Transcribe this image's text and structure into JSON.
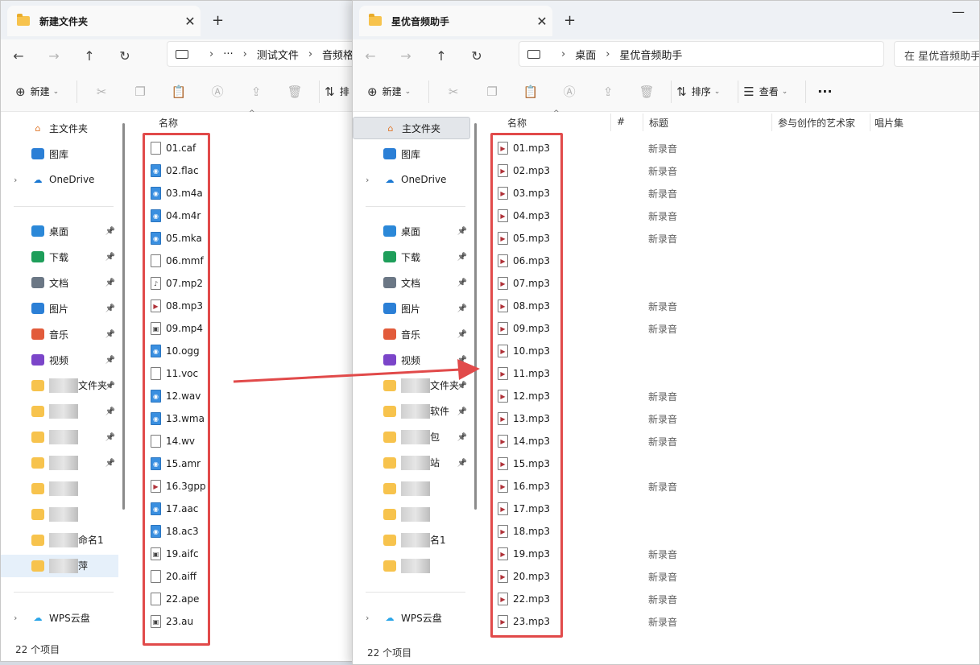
{
  "colors": {
    "accent": "#0067c0",
    "annotation": "#e14a4a",
    "folder": "#f7c34d"
  },
  "window_left": {
    "tab_title": "新建文件夹",
    "address": [
      "测试文件",
      "音频格"
    ],
    "address_more": "···",
    "toolbar": {
      "new_label": "新建",
      "sort_partial": "排"
    },
    "column_name": "名称",
    "files": [
      {
        "name": "01.caf",
        "icon": "file-icon"
      },
      {
        "name": "02.flac",
        "icon": "audio-icon"
      },
      {
        "name": "03.m4a",
        "icon": "audio-icon"
      },
      {
        "name": "04.m4r",
        "icon": "audio-icon"
      },
      {
        "name": "05.mka",
        "icon": "audio-icon"
      },
      {
        "name": "06.mmf",
        "icon": "file-icon"
      },
      {
        "name": "07.mp2",
        "icon": "music-note-icon"
      },
      {
        "name": "08.mp3",
        "icon": "media-icon"
      },
      {
        "name": "09.mp4",
        "icon": "video-icon"
      },
      {
        "name": "10.ogg",
        "icon": "audio-icon"
      },
      {
        "name": "11.voc",
        "icon": "file-icon"
      },
      {
        "name": "12.wav",
        "icon": "audio-icon"
      },
      {
        "name": "13.wma",
        "icon": "audio-icon"
      },
      {
        "name": "14.wv",
        "icon": "file-icon"
      },
      {
        "name": "15.amr",
        "icon": "audio-icon"
      },
      {
        "name": "16.3gpp",
        "icon": "media-icon"
      },
      {
        "name": "17.aac",
        "icon": "audio-icon"
      },
      {
        "name": "18.ac3",
        "icon": "audio-icon"
      },
      {
        "name": "19.aifc",
        "icon": "video-icon"
      },
      {
        "name": "20.aiff",
        "icon": "file-icon"
      },
      {
        "name": "22.ape",
        "icon": "file-icon"
      },
      {
        "name": "23.au",
        "icon": "video-icon"
      }
    ],
    "status": "22 个项目"
  },
  "window_right": {
    "tab_title": "星优音频助手",
    "address": [
      "桌面",
      "星优音频助手"
    ],
    "search_placeholder": "在 星优音频助手",
    "toolbar": {
      "new_label": "新建",
      "sort_label": "排序",
      "view_label": "查看",
      "more": "···"
    },
    "columns": [
      "名称",
      "#",
      "标题",
      "参与创作的艺术家",
      "唱片集"
    ],
    "files": [
      {
        "name": "01.mp3",
        "title": "新录音"
      },
      {
        "name": "02.mp3",
        "title": "新录音"
      },
      {
        "name": "03.mp3",
        "title": "新录音"
      },
      {
        "name": "04.mp3",
        "title": "新录音"
      },
      {
        "name": "05.mp3",
        "title": "新录音"
      },
      {
        "name": "06.mp3",
        "title": ""
      },
      {
        "name": "07.mp3",
        "title": ""
      },
      {
        "name": "08.mp3",
        "title": "新录音"
      },
      {
        "name": "09.mp3",
        "title": "新录音"
      },
      {
        "name": "10.mp3",
        "title": ""
      },
      {
        "name": "11.mp3",
        "title": ""
      },
      {
        "name": "12.mp3",
        "title": "新录音"
      },
      {
        "name": "13.mp3",
        "title": "新录音"
      },
      {
        "name": "14.mp3",
        "title": "新录音"
      },
      {
        "name": "15.mp3",
        "title": ""
      },
      {
        "name": "16.mp3",
        "title": "新录音"
      },
      {
        "name": "17.mp3",
        "title": ""
      },
      {
        "name": "18.mp3",
        "title": ""
      },
      {
        "name": "19.mp3",
        "title": "新录音"
      },
      {
        "name": "20.mp3",
        "title": "新录音"
      },
      {
        "name": "22.mp3",
        "title": "新录音"
      },
      {
        "name": "23.mp3",
        "title": "新录音"
      }
    ],
    "status": "22 个项目"
  },
  "sidebar": {
    "home": "主文件夹",
    "gallery": "图库",
    "onedrive": "OneDrive",
    "pinned": [
      {
        "label": "桌面",
        "icon": "desktop-icon",
        "color": "#2b88d8"
      },
      {
        "label": "下载",
        "icon": "download-icon",
        "color": "#1e9e5a"
      },
      {
        "label": "文档",
        "icon": "document-icon",
        "color": "#6b7785"
      },
      {
        "label": "图片",
        "icon": "pictures-icon",
        "color": "#2b7fd6"
      },
      {
        "label": "音乐",
        "icon": "music-icon",
        "color": "#e25b3b"
      },
      {
        "label": "视频",
        "icon": "videos-icon",
        "color": "#7b45c9"
      }
    ],
    "blurred_left": [
      "文件夹",
      "",
      "",
      "",
      "",
      "",
      "命名1",
      "萍"
    ],
    "blurred_right": [
      "文件夹",
      "软件",
      "包",
      "站",
      "",
      "",
      "名1",
      ""
    ],
    "wps": "WPS云盘"
  }
}
